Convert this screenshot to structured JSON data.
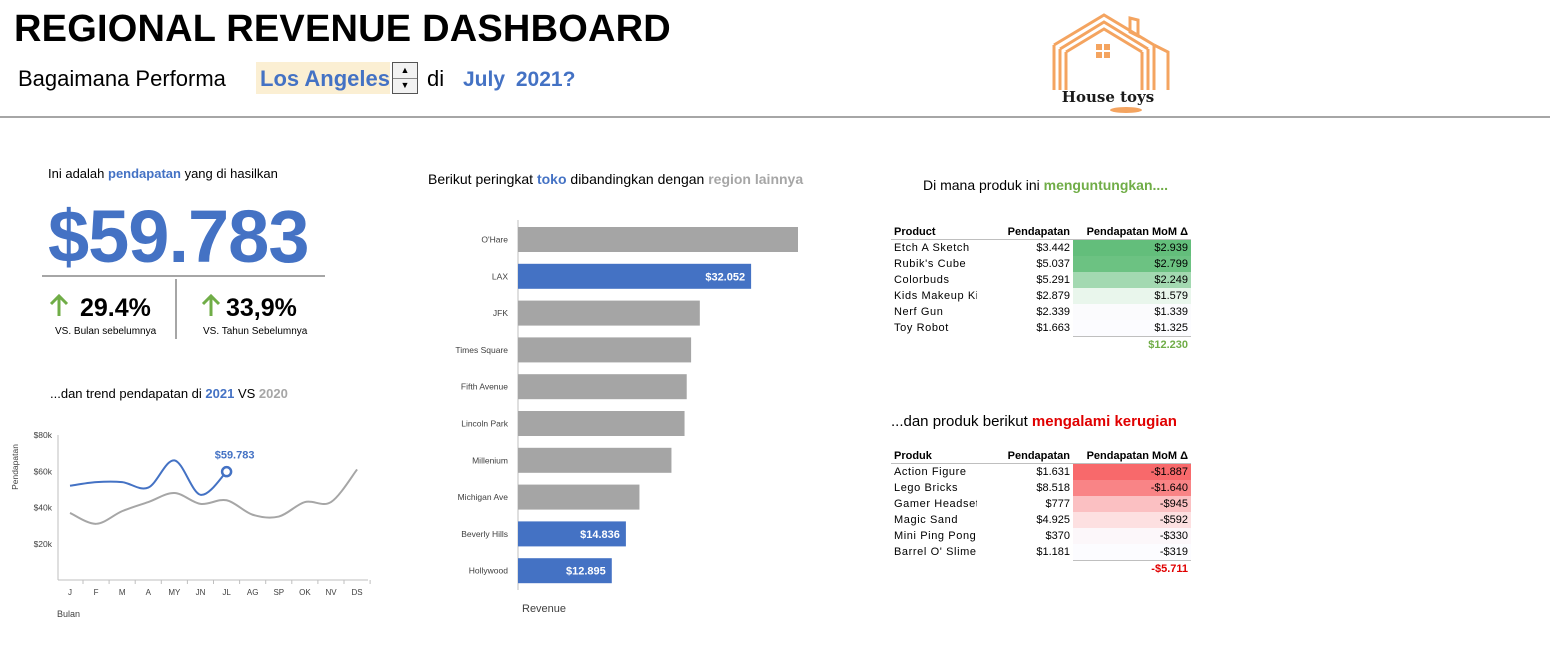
{
  "header": {
    "title": "REGIONAL REVENUE DASHBOARD",
    "question_prefix": "Bagaimana  Performa",
    "city": "Los Angeles",
    "question_mid": "di",
    "period": "July  2021?",
    "logo_text": "House toys"
  },
  "revenue": {
    "caption_pre": "Ini adalah ",
    "caption_hl": "pendapatan",
    "caption_post": " yang di hasilkan",
    "value": "$59.783",
    "mom_pct": "29.4%",
    "mom_label": "VS. Bulan sebelumnya",
    "yoy_pct": "33,9%",
    "yoy_label": "VS. Tahun Sebelumnya",
    "colors": {
      "accent": "#4472c4",
      "up_arrow": "#70ad47"
    }
  },
  "trend": {
    "caption_pre": "...dan trend pendapatan di ",
    "caption_y1": "2021",
    "caption_vs": " VS ",
    "caption_y2": "2020",
    "chart_data": {
      "type": "line",
      "x": [
        "J",
        "F",
        "M",
        "A",
        "MY",
        "JN",
        "JL",
        "AG",
        "SP",
        "OK",
        "NV",
        "DS"
      ],
      "xlabel": "Bulan",
      "ylabel": "Pendapatan",
      "yticks": [
        "$20k",
        "$40k",
        "$60k",
        "$80k"
      ],
      "ylim": [
        0,
        80000
      ],
      "series": [
        {
          "name": "2021",
          "color": "#4472c4",
          "values": [
            52000,
            54000,
            54000,
            51000,
            66000,
            47000,
            59783
          ]
        },
        {
          "name": "2020",
          "color": "#a6a6a6",
          "values": [
            37000,
            31000,
            38000,
            43000,
            48000,
            42000,
            44000,
            36000,
            35000,
            43000,
            43000,
            61000
          ]
        }
      ],
      "annotation": "$59.783"
    }
  },
  "ranking": {
    "caption_pre": "Berikut peringkat ",
    "caption_hl": "toko",
    "caption_mid": " dibandingkan dengan ",
    "caption_grey": "region lainnya",
    "chart_data": {
      "type": "bar",
      "orientation": "horizontal",
      "categories": [
        "O'Hare",
        "LAX",
        "JFK",
        "Times Square",
        "Fifth Avenue",
        "Lincoln Park",
        "Millenium",
        "Michigan Ave",
        "Beverly Hills",
        "Hollywood"
      ],
      "values": [
        38500,
        32052,
        25000,
        23800,
        23200,
        22900,
        21100,
        16700,
        14836,
        12895
      ],
      "highlight": [
        false,
        true,
        false,
        false,
        false,
        false,
        false,
        false,
        true,
        true
      ],
      "data_labels": [
        "",
        "$32.052",
        "",
        "",
        "",
        "",
        "",
        "",
        "$14.836",
        "$12.895"
      ],
      "xlabel": "Revenue",
      "colors": {
        "highlight": "#4472c4",
        "other": "#a5a5a5"
      }
    }
  },
  "gains": {
    "caption_pre": "Di mana produk ini ",
    "caption_hl": "menguntungkan....",
    "columns": [
      "Product",
      "Pendapatan",
      "Pendapatan MoM Δ"
    ],
    "rows": [
      [
        "Etch A Sketch",
        "$3.442",
        "$2.939"
      ],
      [
        "Rubik's Cube",
        "$5.037",
        "$2.799"
      ],
      [
        "Colorbuds",
        "$5.291",
        "$2.249"
      ],
      [
        "Kids Makeup Kit",
        "$2.879",
        "$1.579"
      ],
      [
        "Nerf Gun",
        "$2.339",
        "$1.339"
      ],
      [
        "Toy Robot",
        "$1.663",
        "$1.325"
      ]
    ],
    "row_colors": [
      "#63be7b",
      "#6cc282",
      "#a3d9b1",
      "#e9f6ec",
      "#fbfbfd",
      "#fcfcff"
    ],
    "total": "$12.230",
    "total_color": "#70ad47"
  },
  "losses": {
    "caption_pre": "...dan produk berikut ",
    "caption_hl": "mengalami kerugian",
    "columns": [
      "Produk",
      "Pendapatan",
      "Pendapatan MoM Δ"
    ],
    "rows": [
      [
        "Action Figure",
        "$1.631",
        "-$1.887"
      ],
      [
        "Lego Bricks",
        "$8.518",
        "-$1.640"
      ],
      [
        "Gamer Headset",
        "$777",
        "-$945"
      ],
      [
        "Magic Sand",
        "$4.925",
        "-$592"
      ],
      [
        "Mini Ping Pong",
        "$370",
        "-$330"
      ],
      [
        "Barrel O' Slime",
        "$1.181",
        "-$319"
      ]
    ],
    "row_colors": [
      "#f8696b",
      "#f98486",
      "#fbc0c2",
      "#fde0e1",
      "#fcf7fa",
      "#fcfcff"
    ],
    "total": "-$5.711",
    "total_color": "#e00000"
  }
}
